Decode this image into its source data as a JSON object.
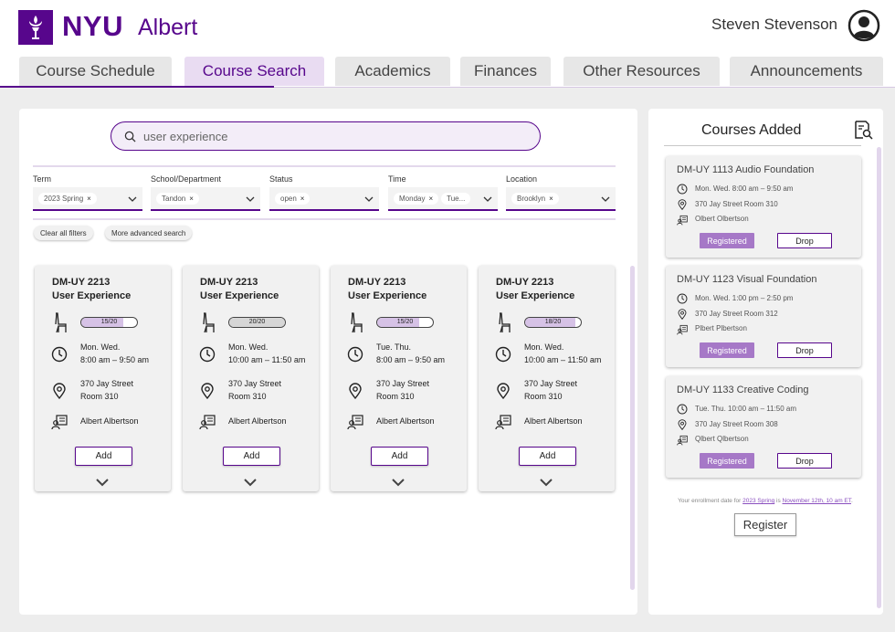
{
  "header": {
    "brand": "NYU",
    "app_name": "Albert",
    "user_name": "Steven Stevenson"
  },
  "tabs": [
    {
      "label": "Course Schedule",
      "active": false
    },
    {
      "label": "Course Search",
      "active": true
    },
    {
      "label": "Academics",
      "active": false
    },
    {
      "label": "Finances",
      "active": false
    },
    {
      "label": "Other Resources",
      "active": false
    },
    {
      "label": "Announcements",
      "active": false
    }
  ],
  "search": {
    "value": "user experience"
  },
  "filters": [
    {
      "label": "Term",
      "chips": [
        "2023 Spring"
      ]
    },
    {
      "label": "School/Department",
      "chips": [
        "Tandon"
      ]
    },
    {
      "label": "Status",
      "chips": [
        "open"
      ]
    },
    {
      "label": "Time",
      "chips": [
        "Monday",
        "Tue..."
      ]
    },
    {
      "label": "Location",
      "chips": [
        "Brooklyn"
      ]
    }
  ],
  "filter_actions": {
    "clear": "Clear all filters",
    "advanced": "More advanced search"
  },
  "results": [
    {
      "code": "DM-UY 2213",
      "title": "User Experience",
      "seats": "15/20",
      "seats_fraction": 0.75,
      "days": "Mon. Wed.",
      "time": "8:00 am – 9:50 am",
      "address": "370 Jay Street",
      "room": "Room 310",
      "instructor": "Albert Albertson",
      "add_label": "Add"
    },
    {
      "code": "DM-UY 2213",
      "title": "User Experience",
      "seats": "20/20",
      "seats_fraction": 1.0,
      "days": "Mon. Wed.",
      "time": "10:00 am – 11:50 am",
      "address": "370 Jay Street",
      "room": "Room 310",
      "instructor": "Albert Albertson",
      "add_label": "Add"
    },
    {
      "code": "DM-UY 2213",
      "title": "User Experience",
      "seats": "15/20",
      "seats_fraction": 0.75,
      "days": "Tue. Thu.",
      "time": "8:00 am – 9:50 am",
      "address": "370 Jay Street",
      "room": "Room 310",
      "instructor": "Albert Albertson",
      "add_label": "Add"
    },
    {
      "code": "DM-UY 2213",
      "title": "User Experience",
      "seats": "18/20",
      "seats_fraction": 0.9,
      "days": "Mon. Wed.",
      "time": "10:00 am – 11:50 am",
      "address": "370 Jay Street",
      "room": "Room 310",
      "instructor": "Albert Albertson",
      "add_label": "Add"
    }
  ],
  "sidebar": {
    "title": "Courses Added",
    "courses": [
      {
        "name": "DM-UY 1113 Audio Foundation",
        "schedule": "Mon. Wed. 8:00 am – 9:50 am",
        "location": "370 Jay Street Room 310",
        "instructor": "Olbert Olbertson",
        "status": "Registered",
        "drop_label": "Drop"
      },
      {
        "name": "DM-UY 1123 Visual Foundation",
        "schedule": "Mon. Wed. 1:00 pm – 2:50 pm",
        "location": "370 Jay Street Room 312",
        "instructor": "Plbert Plbertson",
        "status": "Registered",
        "drop_label": "Drop"
      },
      {
        "name": "DM-UY 1133 Creative Coding",
        "schedule": "Tue. Thu. 10:00 am – 11:50 am",
        "location": "370 Jay Street Room 308",
        "instructor": "Qlbert Qlbertson",
        "status": "Registered",
        "drop_label": "Drop"
      }
    ],
    "enrollment": {
      "prefix": "Your enrollment date for ",
      "term": "2023 Spring",
      "middle": " is ",
      "date": "November 12th, 10 am ET",
      "suffix": "."
    },
    "register_label": "Register"
  },
  "colors": {
    "brand": "#57068c",
    "accent_light": "#e9dcf2",
    "registered": "#a678c7"
  }
}
